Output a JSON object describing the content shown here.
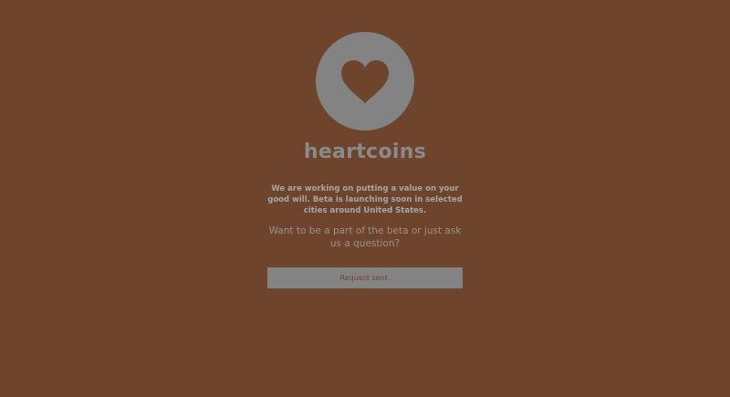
{
  "brand": {
    "name": "heartcoins",
    "logo_icon": "heart-icon"
  },
  "intro": {
    "description": "We are working on putting a value on your good will. Beta is launching soon in selected cities around United States.",
    "question": "Want to be a part of the beta or just ask us a question?"
  },
  "actions": {
    "request_label": "Request sent."
  },
  "colors": {
    "background": "#6e442c",
    "accent": "#838383"
  }
}
